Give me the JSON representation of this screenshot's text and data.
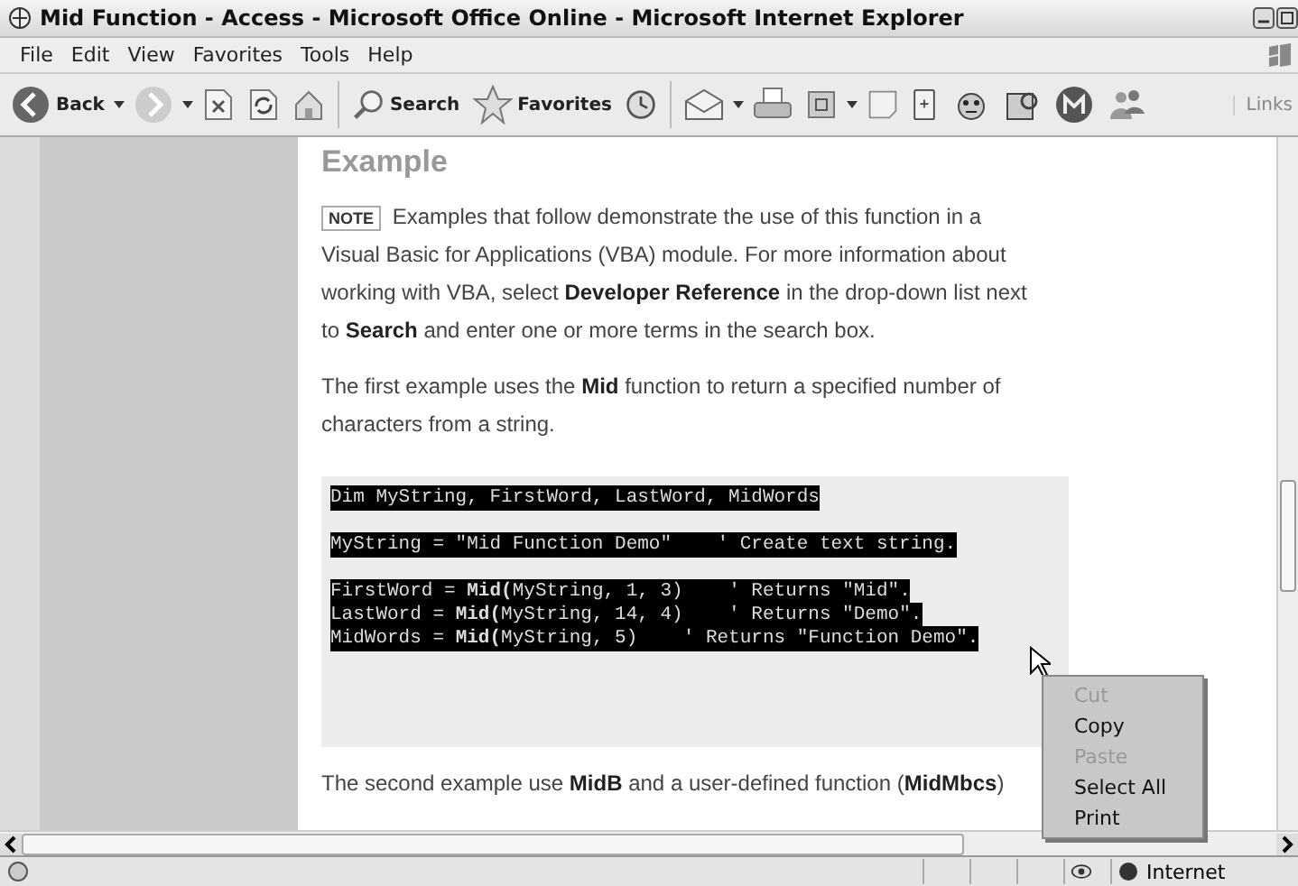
{
  "window": {
    "title": "Mid Function - Access - Microsoft Office Online - Microsoft Internet Explorer"
  },
  "menu": [
    "File",
    "Edit",
    "View",
    "Favorites",
    "Tools",
    "Help"
  ],
  "toolbar": [
    {
      "kind": "back",
      "label": "Back"
    },
    {
      "kind": "dropdown"
    },
    {
      "kind": "forward"
    },
    {
      "kind": "dropdown"
    },
    {
      "kind": "stop"
    },
    {
      "kind": "refresh"
    },
    {
      "kind": "home"
    },
    {
      "kind": "sep"
    },
    {
      "kind": "search",
      "label": "Search"
    },
    {
      "kind": "favorites",
      "label": "Favorites"
    },
    {
      "kind": "history"
    },
    {
      "kind": "sep"
    },
    {
      "kind": "mail"
    },
    {
      "kind": "dropdown"
    },
    {
      "kind": "print"
    },
    {
      "kind": "edit"
    },
    {
      "kind": "dropdown"
    },
    {
      "kind": "note"
    },
    {
      "kind": "phone"
    },
    {
      "kind": "face"
    },
    {
      "kind": "film"
    },
    {
      "kind": "badge"
    },
    {
      "kind": "people"
    }
  ],
  "links": "Links",
  "content": {
    "heading": "Example",
    "note_badge": "NOTE",
    "note": "Examples that follow demonstrate the use of this function in a Visual Basic for Applications (VBA) module. For more information about working with VBA, select **Developer Reference** in the drop-down list next to **Search** and enter one or more terms in the search box.",
    "para1": "The first example uses the **Mid** function to return a specified number of characters from a string.",
    "code": {
      "selected": true,
      "groups": [
        [
          "Dim MyString, FirstWord, LastWord, MidWords"
        ],
        [
          "MyString = \"Mid Function Demo\"    ' Create text string."
        ],
        [
          "FirstWord = **Mid(**MyString, 1, 3)    ' Returns \"Mid\".",
          "LastWord = **Mid(**MyString, 14, 4)    ' Returns \"Demo\".",
          "MidWords = **Mid(**MyString, 5)    ' Returns \"Function Demo\"."
        ]
      ]
    },
    "para2": "The second example use **MidB** and a user-defined function (**MidMbcs**)"
  },
  "context_menu": [
    {
      "label": "Cut",
      "disabled": true
    },
    {
      "label": "Copy",
      "disabled": false
    },
    {
      "label": "Paste",
      "disabled": true
    },
    {
      "label": "Select All",
      "disabled": false
    },
    {
      "label": "Print",
      "disabled": false
    }
  ],
  "status_bar": {
    "zone": "Internet"
  }
}
